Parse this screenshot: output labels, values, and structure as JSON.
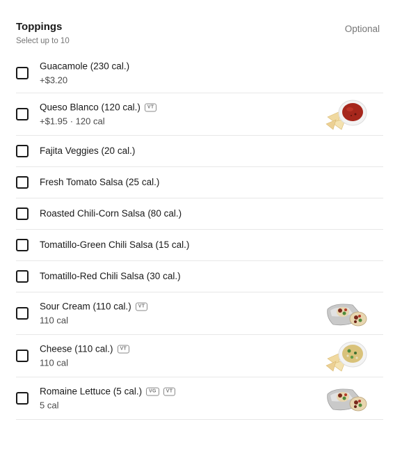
{
  "section": {
    "title": "Toppings",
    "subtitle": "Select up to 10",
    "optional_label": "Optional"
  },
  "items": [
    {
      "name": "Guacamole (230 cal.)",
      "meta": "+$3.20",
      "badges": [],
      "thumb": null,
      "checked": false
    },
    {
      "name": "Queso Blanco (120 cal.)",
      "meta": "+$1.95 · 120 cal",
      "badges": [
        "VT"
      ],
      "thumb": "chips-and-salsa-image",
      "checked": false
    },
    {
      "name": "Fajita Veggies (20 cal.)",
      "meta": null,
      "badges": [],
      "thumb": null,
      "checked": false
    },
    {
      "name": "Fresh Tomato Salsa (25 cal.)",
      "meta": null,
      "badges": [],
      "thumb": null,
      "checked": false
    },
    {
      "name": "Roasted Chili-Corn Salsa (80 cal.)",
      "meta": null,
      "badges": [],
      "thumb": null,
      "checked": false
    },
    {
      "name": "Tomatillo-Green Chili Salsa (15 cal.)",
      "meta": null,
      "badges": [],
      "thumb": null,
      "checked": false
    },
    {
      "name": "Tomatillo-Red Chili Salsa (30 cal.)",
      "meta": null,
      "badges": [],
      "thumb": null,
      "checked": false
    },
    {
      "name": "Sour Cream (110 cal.)",
      "meta": "110 cal",
      "badges": [
        "VT"
      ],
      "thumb": "burrito-image",
      "checked": false
    },
    {
      "name": "Cheese (110 cal.)",
      "meta": "110 cal",
      "badges": [
        "VT"
      ],
      "thumb": "chips-and-dip-image",
      "checked": false
    },
    {
      "name": "Romaine Lettuce (5 cal.)",
      "meta": "5 cal",
      "badges": [
        "VG",
        "VT"
      ],
      "thumb": "burrito-image",
      "checked": false
    }
  ],
  "colors": {
    "text": "#191919",
    "muted": "#767676",
    "divider": "#e7e7e7"
  }
}
